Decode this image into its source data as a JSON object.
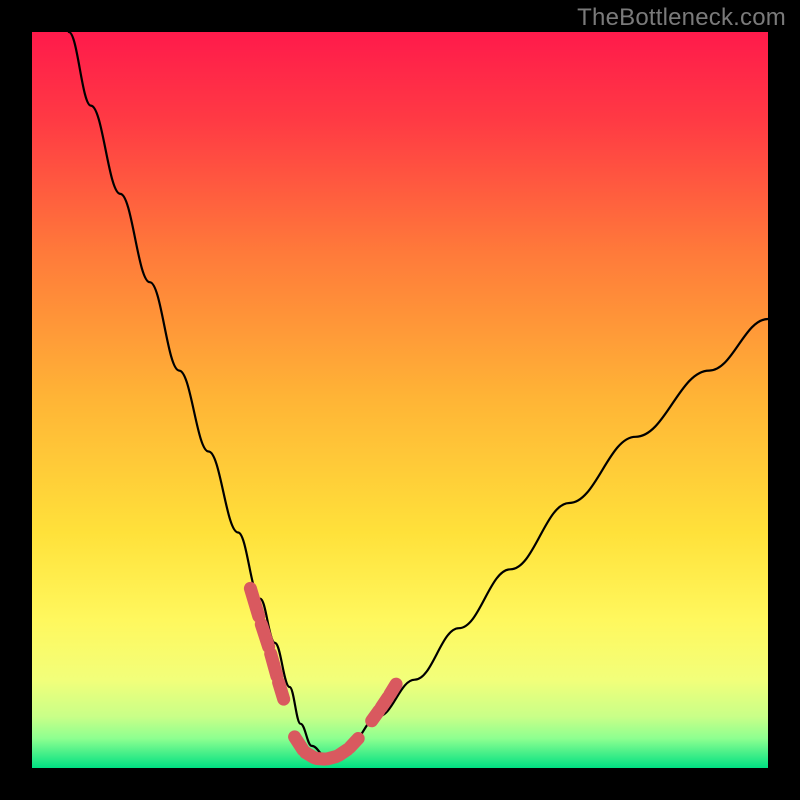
{
  "watermark": "TheBottleneck.com",
  "chart_data": {
    "type": "line",
    "title": "",
    "xlabel": "",
    "ylabel": "",
    "xlim": [
      0,
      100
    ],
    "ylim": [
      0,
      100
    ],
    "grid": false,
    "background_gradient": {
      "top_color": "#ff1a4b",
      "mid_color": "#ffe400",
      "bottom_green_start": "#eaff8e",
      "bottom_green_end": "#00e082"
    },
    "series": [
      {
        "name": "bottleneck-curve",
        "x": [
          5,
          8,
          12,
          16,
          20,
          24,
          28,
          31,
          33,
          35,
          36.5,
          38,
          40,
          43,
          47,
          52,
          58,
          65,
          73,
          82,
          92,
          100
        ],
        "y": [
          100,
          90,
          78,
          66,
          54,
          43,
          32,
          23,
          17,
          11,
          6,
          3,
          1.5,
          3,
          7,
          12,
          19,
          27,
          36,
          45,
          54,
          61
        ]
      }
    ],
    "highlight_segments": [
      {
        "name": "left-near-min",
        "x": [
          29.5,
          31.0,
          32.3,
          33.4,
          34.3
        ],
        "y": [
          25,
          20,
          16,
          12,
          9
        ]
      },
      {
        "name": "minimum-basin",
        "x": [
          35.5,
          37,
          38.5,
          40,
          41.5,
          43,
          44.5
        ],
        "y": [
          4.5,
          2.2,
          1.3,
          1.2,
          1.6,
          2.6,
          4.2
        ]
      },
      {
        "name": "right-near-min",
        "x": [
          46.0,
          47.3,
          48.5,
          49.6
        ],
        "y": [
          6.2,
          8.0,
          9.8,
          11.6
        ]
      }
    ],
    "colors": {
      "curve": "#000000",
      "highlight": "#d9595f"
    }
  }
}
